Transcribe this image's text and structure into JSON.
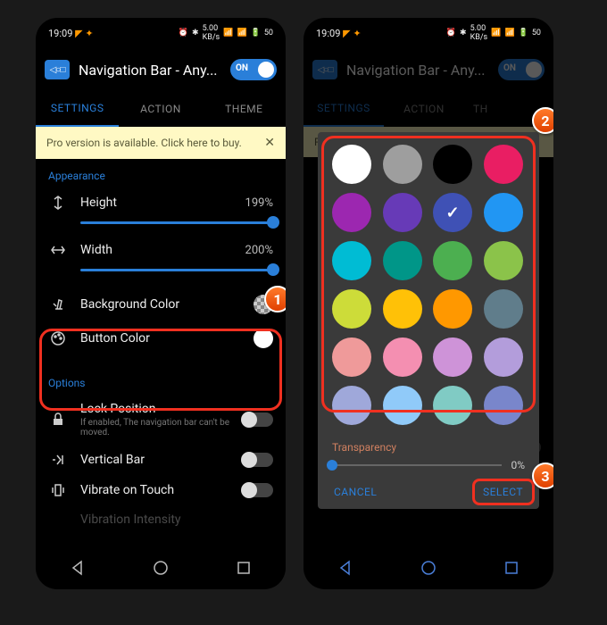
{
  "statusBar": {
    "time": "19:09",
    "batteryPct": "50"
  },
  "appBar": {
    "title": "Navigation Bar - Any...",
    "toggleLabel": "ON"
  },
  "tabs": {
    "settings": "SETTINGS",
    "action": "ACTION",
    "theme": "THEME"
  },
  "banner": {
    "text": "Pro version is available. Click here to buy."
  },
  "sectionAppearance": "Appearance",
  "heightRow": {
    "label": "Height",
    "value": "199%"
  },
  "widthRow": {
    "label": "Width",
    "value": "200%"
  },
  "bgColorRow": {
    "label": "Background Color"
  },
  "btnColorRow": {
    "label": "Button Color"
  },
  "sectionOptions": "Options",
  "lockPositionRow": {
    "label": "Lock Position",
    "sub": "If enabled, The navigation bar can't be moved."
  },
  "verticalBarRow": {
    "label": "Vertical Bar"
  },
  "vibrateRow": {
    "label": "Vibrate on Touch"
  },
  "intensityRow": {
    "label": "Vibration Intensity"
  },
  "dialog": {
    "colors": [
      "#ffffff",
      "#9e9e9e",
      "#000000",
      "#e91e63",
      "#9c27b0",
      "#673ab7",
      "#3f51b5",
      "#2196f3",
      "#00bcd4",
      "#009688",
      "#4caf50",
      "#8bc34a",
      "#cddc39",
      "#ffc107",
      "#ff9800",
      "#607d8b",
      "#ef9a9a",
      "#f48fb1",
      "#ce93d8",
      "#b39ddb",
      "#9fa8da",
      "#90caf9",
      "#80cbc4",
      "#7986cb"
    ],
    "selectedIndex": 6,
    "transparencyLabel": "Transparency",
    "transparencyValue": "0%",
    "cancel": "CANCEL",
    "select": "SELECT"
  },
  "callouts": {
    "c1": "1",
    "c2": "2",
    "c3": "3"
  }
}
